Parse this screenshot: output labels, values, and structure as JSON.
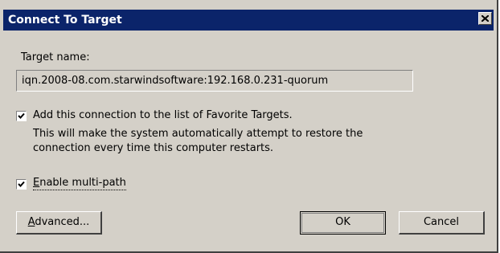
{
  "dialog": {
    "title": "Connect To Target",
    "close_icon": "close-icon"
  },
  "target": {
    "label": "Target name:",
    "value": "iqn.2008-08.com.starwindsoftware:192.168.0.231-quorum"
  },
  "favorite": {
    "checked": true,
    "label": "Add this connection to the list of Favorite Targets.",
    "description_line1": "This will make the system automatically attempt to restore the",
    "description_line2": "connection every time this computer restarts."
  },
  "multipath": {
    "checked": true,
    "label_accel": "E",
    "label_rest": "nable multi-path"
  },
  "buttons": {
    "advanced_accel": "A",
    "advanced_rest": "dvanced...",
    "ok": "OK",
    "cancel": "Cancel"
  },
  "colors": {
    "title_bar": "#0b246a",
    "face": "#d4d0c8"
  }
}
